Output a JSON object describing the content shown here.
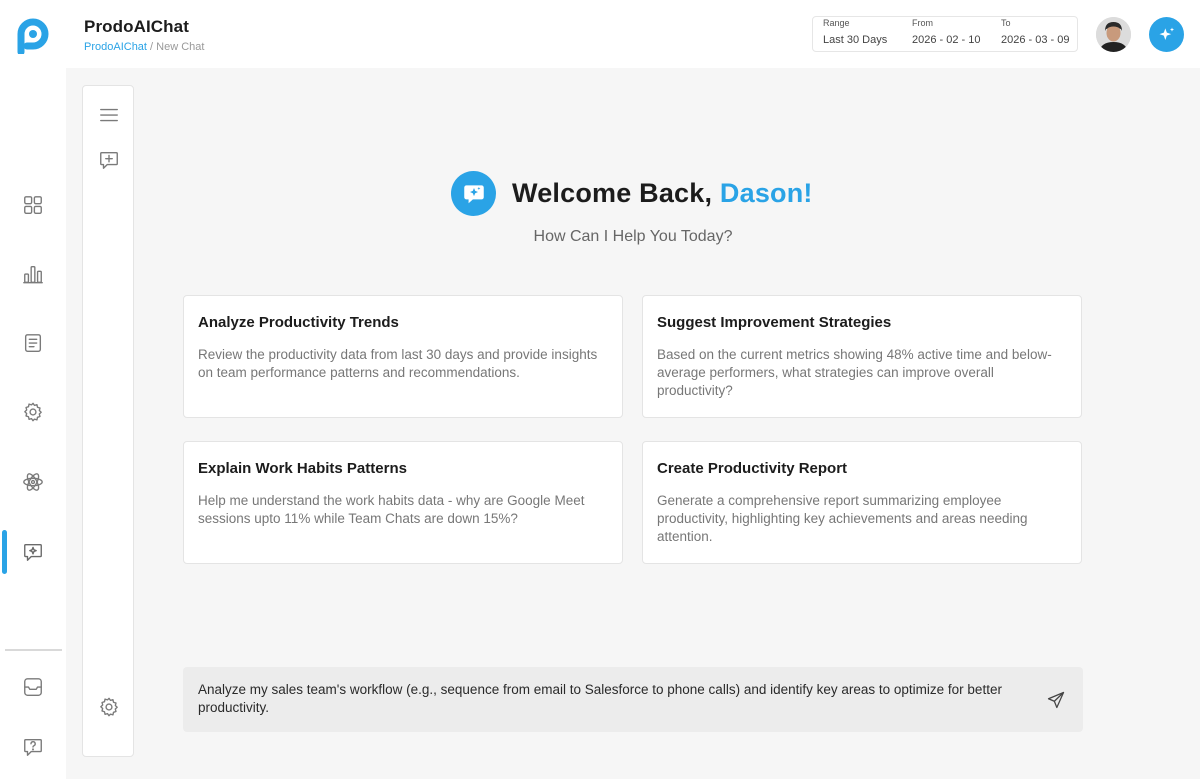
{
  "app": {
    "title": "ProdoAIChat",
    "breadcrumb_root": "ProdoAIChat",
    "breadcrumb_sep": " / ",
    "breadcrumb_current": "New Chat",
    "accent_color": "#2aa3e6"
  },
  "date_filter": {
    "range_label": "Range",
    "range_value": "Last 30 Days",
    "from_label": "From",
    "from_value": "2026 - 02 - 10",
    "to_label": "To",
    "to_value": "2026 - 03 - 09"
  },
  "rail": {
    "items": [
      {
        "icon": "grid-icon"
      },
      {
        "icon": "bar-chart-icon"
      },
      {
        "icon": "document-icon"
      },
      {
        "icon": "gear-icon"
      },
      {
        "icon": "atom-icon"
      },
      {
        "icon": "ai-chat-icon",
        "active": true
      }
    ],
    "bottom": [
      {
        "icon": "inbox-smile-icon"
      },
      {
        "icon": "help-icon"
      }
    ]
  },
  "welcome": {
    "greeting": "Welcome Back, ",
    "name": "Dason!",
    "subtitle": "How Can I Help You Today?"
  },
  "cards": [
    {
      "title": "Analyze Productivity Trends",
      "description": "Review the productivity data from last 30 days and provide insights on team performance patterns and recommendations."
    },
    {
      "title": "Suggest Improvement Strategies",
      "description": "Based on the current metrics showing 48% active time and below-average performers, what strategies can improve overall productivity?"
    },
    {
      "title": "Explain Work Habits Patterns",
      "description": "Help me understand the work habits data - why are Google Meet sessions upto 11% while Team Chats are down 15%?"
    },
    {
      "title": "Create Productivity Report",
      "description": "Generate a comprehensive report summarizing employee productivity, highlighting key achievements and areas needing attention."
    }
  ],
  "composer": {
    "text": "Analyze my sales team's workflow (e.g., sequence from email to Salesforce to phone calls) and identify key areas to optimize for better productivity."
  }
}
